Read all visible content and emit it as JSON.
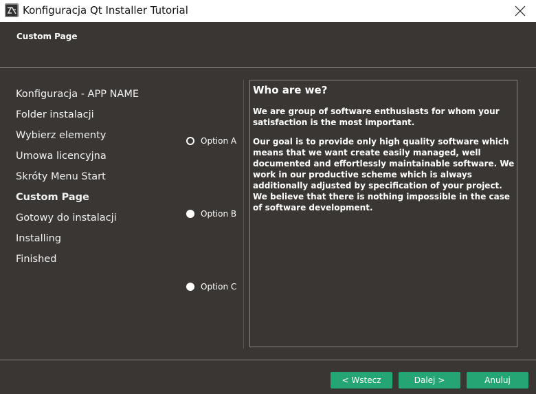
{
  "window": {
    "title": "Konfiguracja Qt Installer Tutorial"
  },
  "header": {
    "title": "Custom Page"
  },
  "steps": [
    {
      "label": "Konfiguracja - APP NAME"
    },
    {
      "label": "Folder instalacji"
    },
    {
      "label": "Wybierz elementy"
    },
    {
      "label": "Umowa licencyjna"
    },
    {
      "label": "Skróty Menu Start"
    },
    {
      "label": "Custom Page"
    },
    {
      "label": "Gotowy do instalacji"
    },
    {
      "label": "Installing"
    },
    {
      "label": "Finished"
    }
  ],
  "options": [
    {
      "label": "Option A",
      "selected": false
    },
    {
      "label": "Option B",
      "selected": true
    },
    {
      "label": "Option C",
      "selected": true
    }
  ],
  "info": {
    "heading": "Who are we?",
    "paragraph1": "We are group of software enthusiasts for whom your satisfaction is the most important.",
    "paragraph2": "Our goal is to provide only high quality software which means that we want create easily managed, well documented and effortlessly maintainable software. We work in our productive scheme which is always additionally adjusted by specification of your project. We believe that there is nothing impossible in the case of software development."
  },
  "buttons": {
    "back": "< Wstecz",
    "next": "Dalej >",
    "cancel": "Anuluj"
  },
  "colors": {
    "background": "#3a3634",
    "button": "#26a574"
  }
}
